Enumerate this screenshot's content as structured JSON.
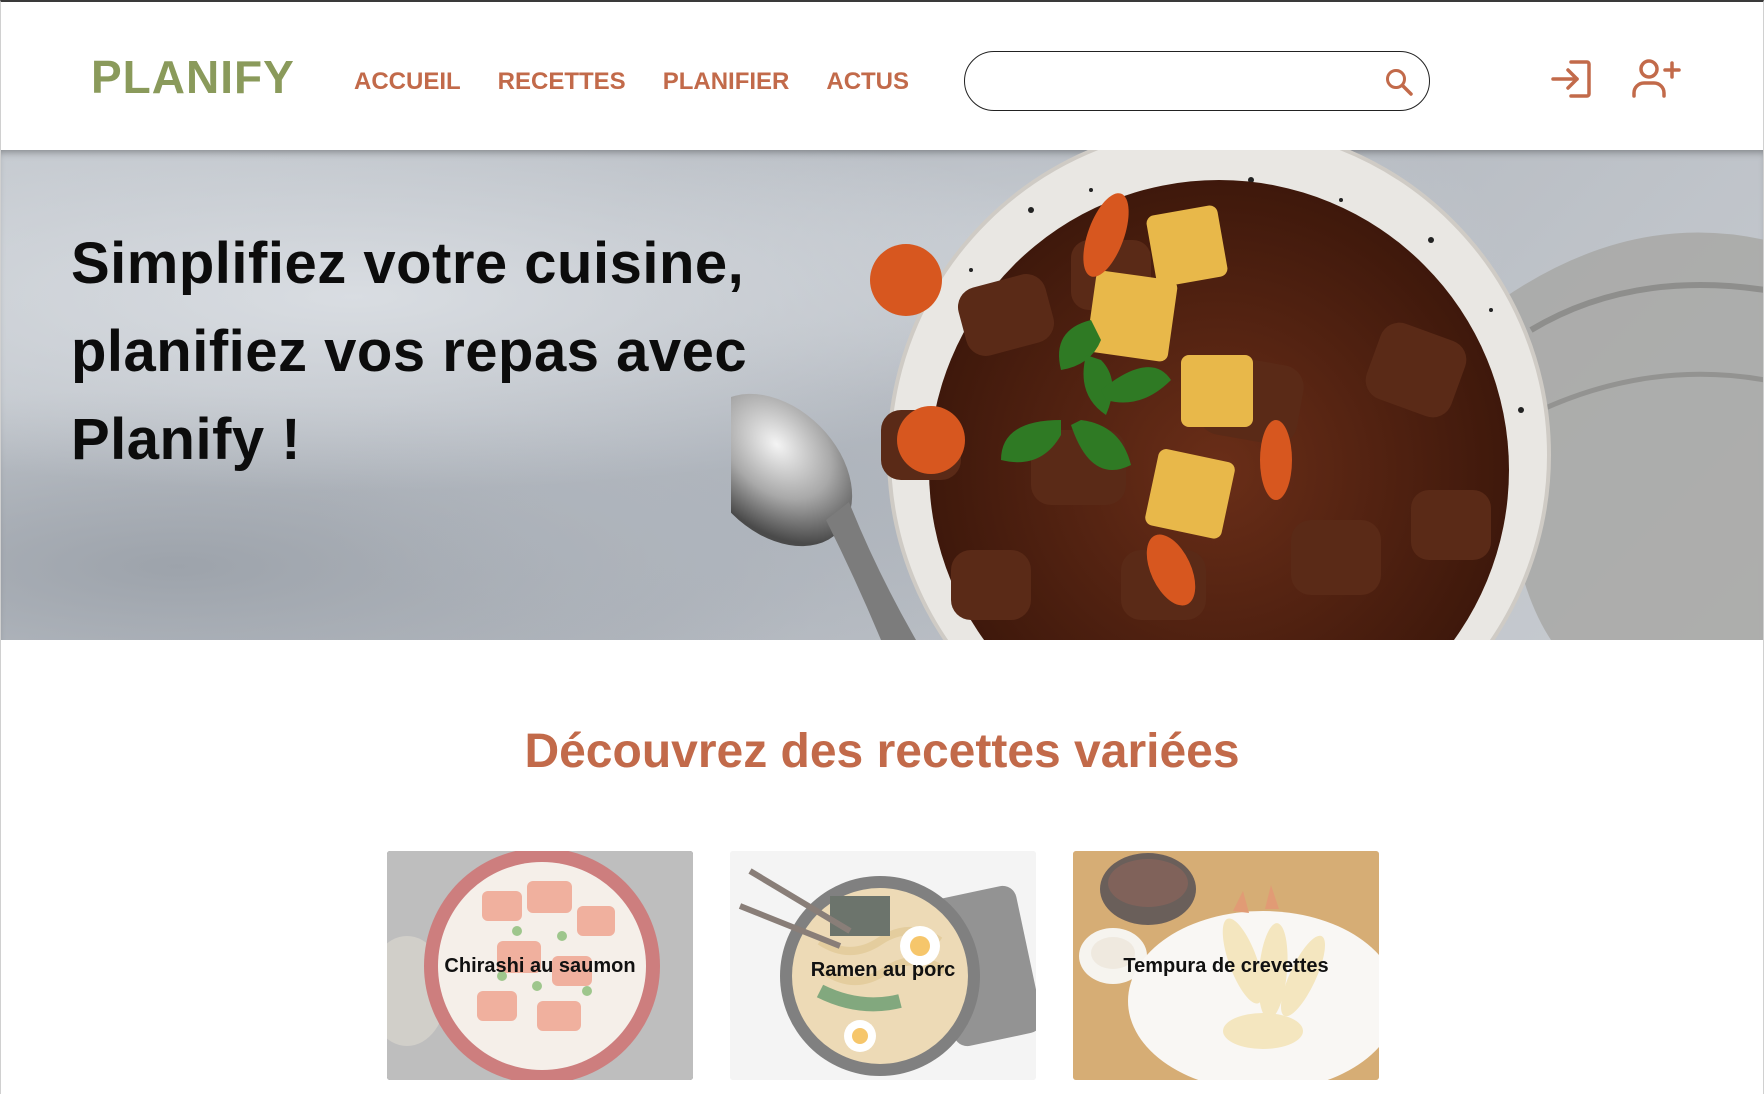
{
  "header": {
    "logo": "PLANIFY",
    "nav": [
      "ACCUEIL",
      "RECETTES",
      "PLANIFIER",
      "ACTUS"
    ],
    "search": {
      "value": "",
      "icon": "search-icon"
    },
    "actions": [
      {
        "icon": "login-icon"
      },
      {
        "icon": "add-user-icon"
      }
    ]
  },
  "hero": {
    "title": "Simplifiez votre cuisine, planifiez vos repas avec Planify !"
  },
  "section": {
    "title": "Découvrez des recettes variées"
  },
  "recipes": [
    {
      "name": "Chirashi au saumon"
    },
    {
      "name": "Ramen au porc"
    },
    {
      "name": "Tempura de crevettes"
    }
  ],
  "colors": {
    "logo": "#8a9a5b",
    "accent": "#c26a4a",
    "text": "#0c0c0c"
  }
}
